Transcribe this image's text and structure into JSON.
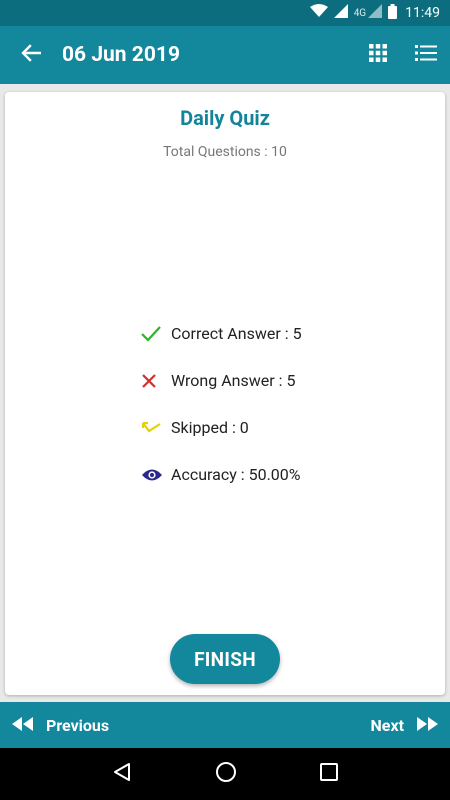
{
  "status_bar": {
    "network": "4G",
    "time": "11:49"
  },
  "app_bar": {
    "title": "06 Jun 2019"
  },
  "quiz": {
    "title": "Daily Quiz",
    "total_questions": "Total Questions  : 10",
    "stats": [
      {
        "icon": "check-icon",
        "label": "Correct Answer : 5"
      },
      {
        "icon": "cross-icon",
        "label": "Wrong Answer : 5"
      },
      {
        "icon": "skip-icon",
        "label": "Skipped : 0"
      },
      {
        "icon": "eye-icon",
        "label": "Accuracy : 50.00%"
      }
    ],
    "finish_label": "FINISH"
  },
  "bottom_nav": {
    "previous_label": "Previous",
    "next_label": "Next"
  },
  "colors": {
    "primary": "#13879b",
    "status_bar": "#0b6d7e",
    "correct": "#2bb52b",
    "wrong": "#d32f2f",
    "skipped": "#e6d200",
    "accuracy": "#2a2a8c"
  }
}
